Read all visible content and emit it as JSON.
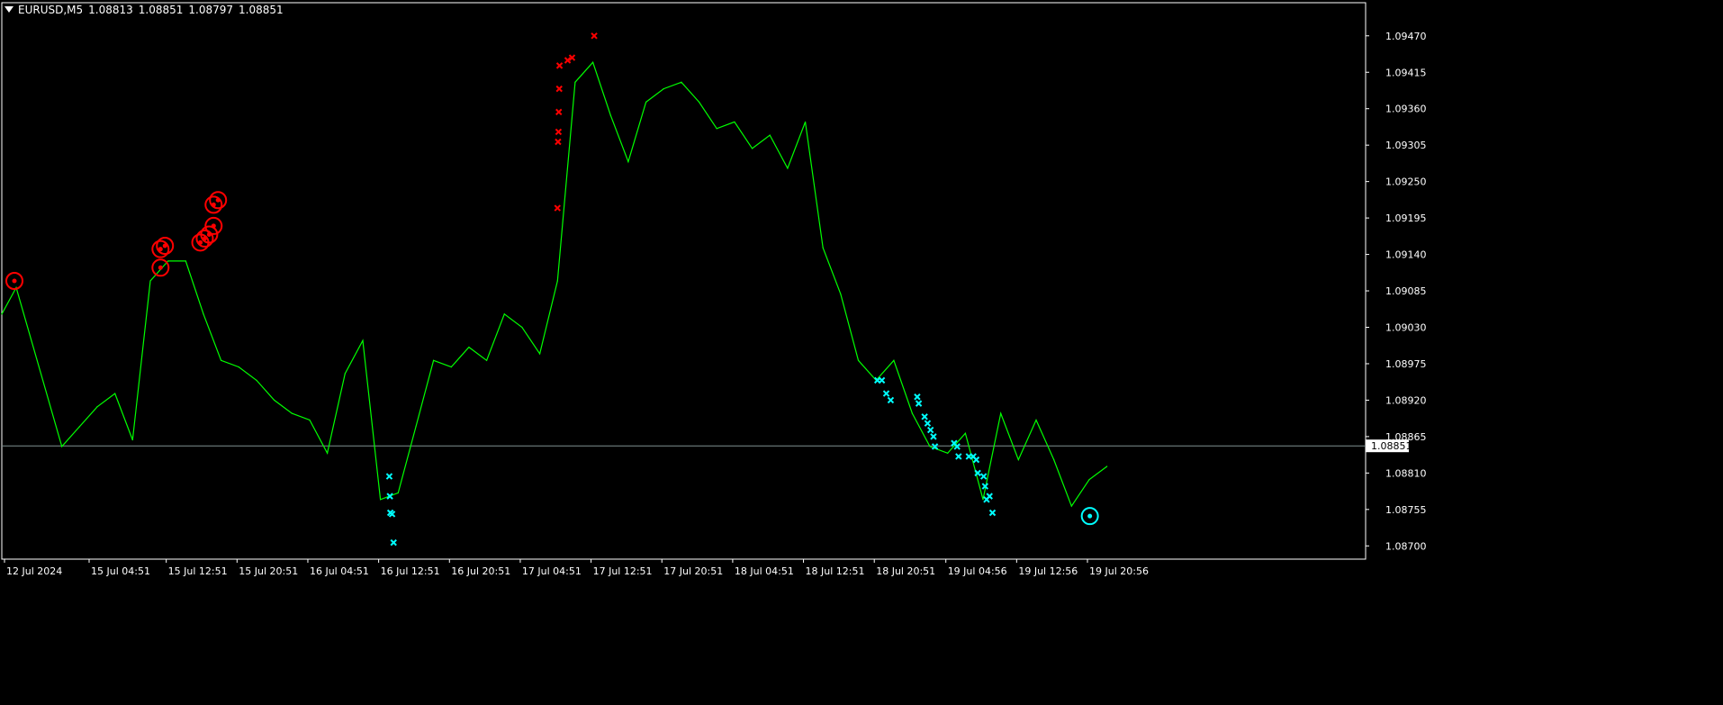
{
  "header": {
    "symbol": "EURUSD,M5",
    "open": "1.08813",
    "high": "1.08851",
    "low": "1.08797",
    "close": "1.08851"
  },
  "colors": {
    "background": "#000000",
    "line": "#00ff00",
    "sell_marker": "#ff0000",
    "buy_marker": "#00ffff",
    "frame": "#ffffff",
    "price_line": "#7f8f8f"
  },
  "chart_data": {
    "type": "line",
    "ylim": [
      1.0868,
      1.0952
    ],
    "y_ticks": [
      "1.09470",
      "1.09415",
      "1.09360",
      "1.09305",
      "1.09250",
      "1.09195",
      "1.09140",
      "1.09085",
      "1.09030",
      "1.08975",
      "1.08920",
      "1.08865",
      "1.08810",
      "1.08755",
      "1.08700"
    ],
    "x_ticks": [
      "12 Jul 2024",
      "15 Jul 04:51",
      "15 Jul 12:51",
      "15 Jul 20:51",
      "16 Jul 04:51",
      "16 Jul 12:51",
      "16 Jul 20:51",
      "17 Jul 04:51",
      "17 Jul 12:51",
      "17 Jul 20:51",
      "18 Jul 04:51",
      "18 Jul 12:51",
      "18 Jul 20:51",
      "19 Jul 04:56",
      "19 Jul 12:56",
      "19 Jul 20:56"
    ],
    "current_price": "1.08851",
    "grid": false,
    "series": [
      {
        "x": [
          "12 Jul 2024",
          "12 Jul 2024",
          "15 Jul 00:51",
          "15 Jul 02:51",
          "15 Jul 04:51",
          "15 Jul 06:51",
          "15 Jul 08:51",
          "15 Jul 10:51",
          "15 Jul 12:51",
          "15 Jul 14:51",
          "15 Jul 16:51",
          "15 Jul 18:51",
          "15 Jul 20:51",
          "15 Jul 22:51",
          "16 Jul 00:51",
          "16 Jul 02:51",
          "16 Jul 04:51",
          "16 Jul 06:51",
          "16 Jul 08:51",
          "16 Jul 10:51",
          "16 Jul 12:51",
          "16 Jul 14:51",
          "16 Jul 16:51",
          "16 Jul 18:51",
          "16 Jul 20:51",
          "16 Jul 22:51",
          "17 Jul 00:51",
          "17 Jul 02:51",
          "17 Jul 04:51",
          "17 Jul 06:51",
          "17 Jul 08:51",
          "17 Jul 10:51",
          "17 Jul 12:51",
          "17 Jul 14:51",
          "17 Jul 16:51",
          "17 Jul 18:51",
          "17 Jul 20:51",
          "17 Jul 22:51",
          "18 Jul 00:51",
          "18 Jul 02:51",
          "18 Jul 04:51",
          "18 Jul 06:51",
          "18 Jul 08:51",
          "18 Jul 10:51",
          "18 Jul 12:51",
          "18 Jul 14:51",
          "18 Jul 16:51",
          "18 Jul 18:51",
          "18 Jul 20:51",
          "18 Jul 22:51",
          "19 Jul 00:56",
          "19 Jul 02:56",
          "19 Jul 04:56",
          "19 Jul 06:56",
          "19 Jul 08:56",
          "19 Jul 10:56",
          "19 Jul 12:56",
          "19 Jul 14:56",
          "19 Jul 16:56",
          "19 Jul 18:56",
          "19 Jul 20:56",
          "19 Jul 22:56"
        ],
        "y": [
          1.0905,
          1.0909,
          1.0885,
          1.0888,
          1.0891,
          1.0893,
          1.0886,
          1.091,
          1.0913,
          1.0913,
          1.0905,
          1.0898,
          1.0897,
          1.0895,
          1.0892,
          1.089,
          1.0889,
          1.0884,
          1.0896,
          1.0901,
          1.0877,
          1.0878,
          1.0888,
          1.0898,
          1.0897,
          1.09,
          1.0898,
          1.0905,
          1.0903,
          1.0899,
          1.091,
          1.094,
          1.0943,
          1.0935,
          1.0928,
          1.0937,
          1.0939,
          1.094,
          1.0937,
          1.0933,
          1.0934,
          1.093,
          1.0932,
          1.0927,
          1.0934,
          1.0915,
          1.0908,
          1.0898,
          1.0895,
          1.0898,
          1.089,
          1.0885,
          1.0884,
          1.0887,
          1.0877,
          1.089,
          1.0883,
          1.0889,
          1.0883,
          1.0876,
          1.088,
          1.0882
        ]
      }
    ],
    "markers": {
      "sell_circles": [
        {
          "x": "12 Jul 2024",
          "y": 1.091
        },
        {
          "x": "15 Jul 12:00",
          "y": 1.0912
        },
        {
          "x": "15 Jul 12:00",
          "y": 1.09148
        },
        {
          "x": "15 Jul 12:30",
          "y": 1.09153
        },
        {
          "x": "15 Jul 16:30",
          "y": 1.09158
        },
        {
          "x": "15 Jul 17:00",
          "y": 1.09164
        },
        {
          "x": "15 Jul 17:30",
          "y": 1.0917
        },
        {
          "x": "15 Jul 18:00",
          "y": 1.09183
        },
        {
          "x": "15 Jul 18:00",
          "y": 1.09215
        },
        {
          "x": "15 Jul 18:30",
          "y": 1.09222
        }
      ],
      "sell_crosses": [
        {
          "x": "17 Jul 08:51",
          "y": 1.0921
        },
        {
          "x": "17 Jul 08:55",
          "y": 1.0931
        },
        {
          "x": "17 Jul 08:58",
          "y": 1.09325
        },
        {
          "x": "17 Jul 09:00",
          "y": 1.09355
        },
        {
          "x": "17 Jul 09:03",
          "y": 1.0939
        },
        {
          "x": "17 Jul 09:05",
          "y": 1.09425
        },
        {
          "x": "17 Jul 10:00",
          "y": 1.09433
        },
        {
          "x": "17 Jul 10:30",
          "y": 1.09437
        },
        {
          "x": "17 Jul 13:00",
          "y": 1.0947
        }
      ],
      "buy_crosses": [
        {
          "x": "16 Jul 13:51",
          "y": 1.08805
        },
        {
          "x": "16 Jul 13:55",
          "y": 1.08775
        },
        {
          "x": "16 Jul 13:58",
          "y": 1.0875
        },
        {
          "x": "16 Jul 14:10",
          "y": 1.08748
        },
        {
          "x": "16 Jul 14:20",
          "y": 1.08705
        },
        {
          "x": "18 Jul 21:00",
          "y": 1.0895
        },
        {
          "x": "18 Jul 21:30",
          "y": 1.0895
        },
        {
          "x": "18 Jul 22:00",
          "y": 1.0893
        },
        {
          "x": "18 Jul 22:30",
          "y": 1.0892
        },
        {
          "x": "19 Jul 01:30",
          "y": 1.08925
        },
        {
          "x": "19 Jul 01:40",
          "y": 1.08915
        },
        {
          "x": "19 Jul 02:20",
          "y": 1.08895
        },
        {
          "x": "19 Jul 02:40",
          "y": 1.08885
        },
        {
          "x": "19 Jul 03:00",
          "y": 1.08875
        },
        {
          "x": "19 Jul 03:20",
          "y": 1.08865
        },
        {
          "x": "19 Jul 03:30",
          "y": 1.0885
        },
        {
          "x": "19 Jul 05:40",
          "y": 1.08855
        },
        {
          "x": "19 Jul 06:00",
          "y": 1.0885
        },
        {
          "x": "19 Jul 06:10",
          "y": 1.08835
        },
        {
          "x": "19 Jul 07:20",
          "y": 1.08835
        },
        {
          "x": "19 Jul 07:50",
          "y": 1.08835
        },
        {
          "x": "19 Jul 08:10",
          "y": 1.0883
        },
        {
          "x": "19 Jul 08:20",
          "y": 1.0881
        },
        {
          "x": "19 Jul 09:00",
          "y": 1.08805
        },
        {
          "x": "19 Jul 09:10",
          "y": 1.0879
        },
        {
          "x": "19 Jul 09:20",
          "y": 1.0877
        },
        {
          "x": "19 Jul 09:40",
          "y": 1.08775
        },
        {
          "x": "19 Jul 10:00",
          "y": 1.0875
        }
      ],
      "buy_circles": [
        {
          "x": "19 Jul 21:00",
          "y": 1.08745
        }
      ]
    }
  }
}
